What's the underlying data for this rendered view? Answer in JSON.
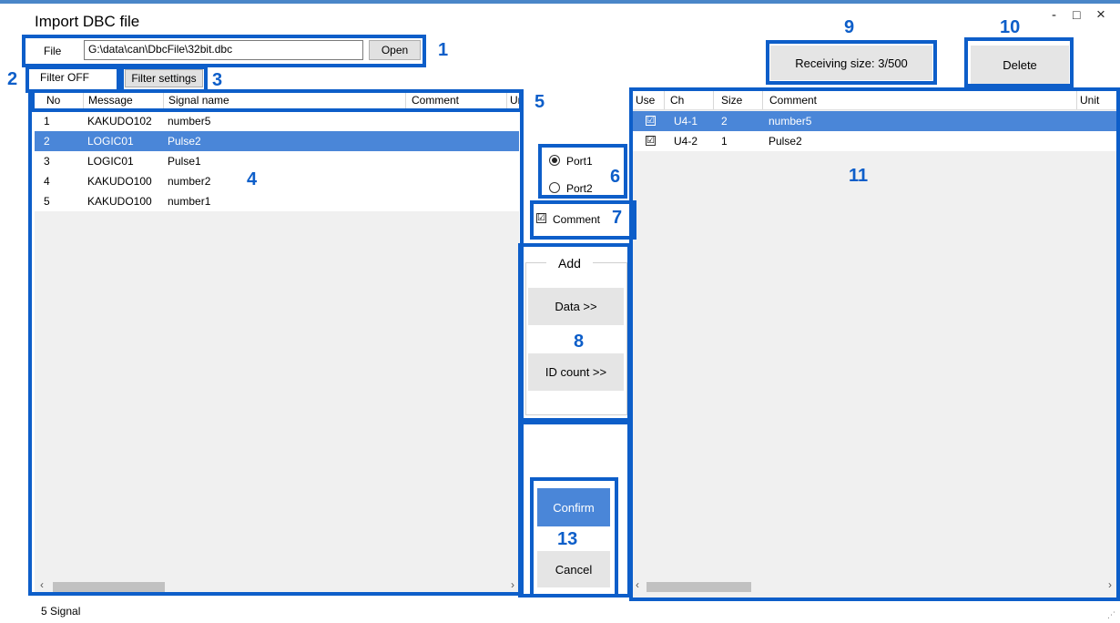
{
  "window": {
    "title": "Import DBC file",
    "minimize": "-",
    "maximize": "□",
    "close": "×"
  },
  "file": {
    "label": "File",
    "path": "G:\\data\\can\\DbcFile\\32bit.dbc",
    "open_label": "Open"
  },
  "filter": {
    "status": "Filter OFF",
    "settings_label": "Filter settings"
  },
  "receiving_size": "Receiving size: 3/500",
  "delete_label": "Delete",
  "left_table": {
    "headers": {
      "no": "No",
      "message": "Message",
      "signal": "Signal name",
      "comment": "Comment",
      "unit": "Ur"
    },
    "rows": [
      {
        "no": "1",
        "message": "KAKUDO102",
        "signal": "number5"
      },
      {
        "no": "2",
        "message": "LOGIC01",
        "signal": "Pulse2"
      },
      {
        "no": "3",
        "message": "LOGIC01",
        "signal": "Pulse1"
      },
      {
        "no": "4",
        "message": "KAKUDO100",
        "signal": "number2"
      },
      {
        "no": "5",
        "message": "KAKUDO100",
        "signal": "number1"
      }
    ],
    "selected_index": 1
  },
  "right_table": {
    "headers": {
      "use": "Use",
      "ch": "Ch",
      "size": "Size",
      "comment": "Comment",
      "unit": "Unit"
    },
    "rows": [
      {
        "use": "☑",
        "ch": "U4-1",
        "size": "2",
        "comment": "number5"
      },
      {
        "use": "☑",
        "ch": "U4-2",
        "size": "1",
        "comment": "Pulse2"
      }
    ],
    "selected_index": 0
  },
  "port": {
    "options": [
      "Port1",
      "Port2"
    ],
    "selected": "Port1"
  },
  "comment_option": {
    "label": "Comment",
    "checked": true,
    "mark": "☑"
  },
  "add": {
    "legend": "Add",
    "data_label": "Data >>",
    "id_count_label": "ID count >>"
  },
  "confirm_label": "Confirm",
  "cancel_label": "Cancel",
  "status_bar": "5 Signal",
  "callouts": [
    "1",
    "2",
    "3",
    "4",
    "5",
    "6",
    "7",
    "8",
    "9",
    "10",
    "11",
    "13"
  ],
  "colors": {
    "callout": "#0d5ec9",
    "selection": "#4a86d8",
    "confirm": "#4a86d8"
  }
}
